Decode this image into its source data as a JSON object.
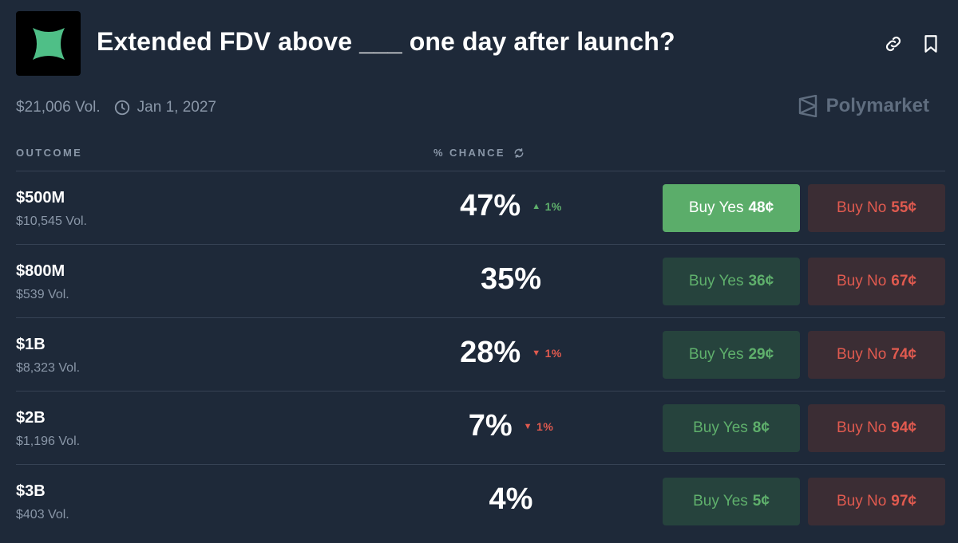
{
  "header": {
    "title": "Extended FDV above ___ one day after launch?",
    "logo_icon": "extended-star-logo",
    "link_icon": "link-icon",
    "bookmark_icon": "bookmark-icon"
  },
  "meta": {
    "volume": "$21,006 Vol.",
    "date": "Jan 1, 2027",
    "brand": "Polymarket"
  },
  "columns": {
    "outcome": "OUTCOME",
    "chance": "% CHANCE"
  },
  "colors": {
    "background": "#1e2939",
    "yes_green": "#5fb06c",
    "yes_active_bg": "#5bad6a",
    "yes_bg": "#26433d",
    "no_red": "#e05a4f",
    "no_bg": "#3b2d34"
  },
  "outcomes": [
    {
      "name": "$500M",
      "volume": "$10,545 Vol.",
      "chance": "47%",
      "delta": "1%",
      "delta_dir": "up",
      "yes_label": "Buy Yes",
      "yes_price": "48¢",
      "no_label": "Buy No",
      "no_price": "55¢",
      "yes_active": true
    },
    {
      "name": "$800M",
      "volume": "$539 Vol.",
      "chance": "35%",
      "delta": "",
      "delta_dir": "",
      "yes_label": "Buy Yes",
      "yes_price": "36¢",
      "no_label": "Buy No",
      "no_price": "67¢",
      "yes_active": false
    },
    {
      "name": "$1B",
      "volume": "$8,323 Vol.",
      "chance": "28%",
      "delta": "1%",
      "delta_dir": "down",
      "yes_label": "Buy Yes",
      "yes_price": "29¢",
      "no_label": "Buy No",
      "no_price": "74¢",
      "yes_active": false
    },
    {
      "name": "$2B",
      "volume": "$1,196 Vol.",
      "chance": "7%",
      "delta": "1%",
      "delta_dir": "down",
      "yes_label": "Buy Yes",
      "yes_price": "8¢",
      "no_label": "Buy No",
      "no_price": "94¢",
      "yes_active": false
    },
    {
      "name": "$3B",
      "volume": "$403 Vol.",
      "chance": "4%",
      "delta": "",
      "delta_dir": "",
      "yes_label": "Buy Yes",
      "yes_price": "5¢",
      "no_label": "Buy No",
      "no_price": "97¢",
      "yes_active": false
    }
  ]
}
